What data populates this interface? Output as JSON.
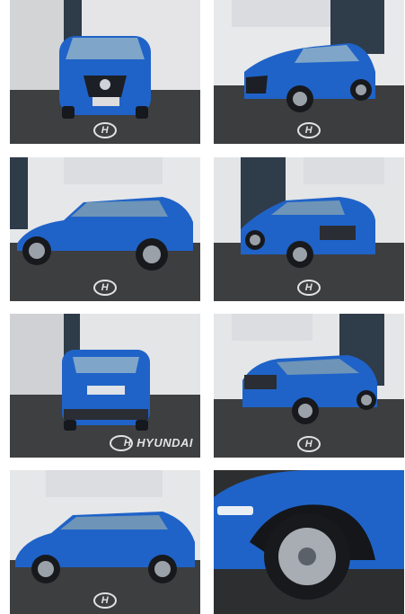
{
  "gallery": {
    "photos": [
      {
        "view": "front"
      },
      {
        "view": "front-three-quarter"
      },
      {
        "view": "side-left"
      },
      {
        "view": "rear-three-quarter-left"
      },
      {
        "view": "rear"
      },
      {
        "view": "rear-three-quarter-right"
      },
      {
        "view": "side-left-alt"
      },
      {
        "view": "wheel-detail"
      }
    ],
    "watermark_letter": "H",
    "brand_text": "HYUNDAI"
  },
  "colors": {
    "car_blue": "#1f63c8",
    "car_dark": "#2a2d33",
    "wall": "#e3e4e6",
    "ground": "#3b3c3e"
  }
}
